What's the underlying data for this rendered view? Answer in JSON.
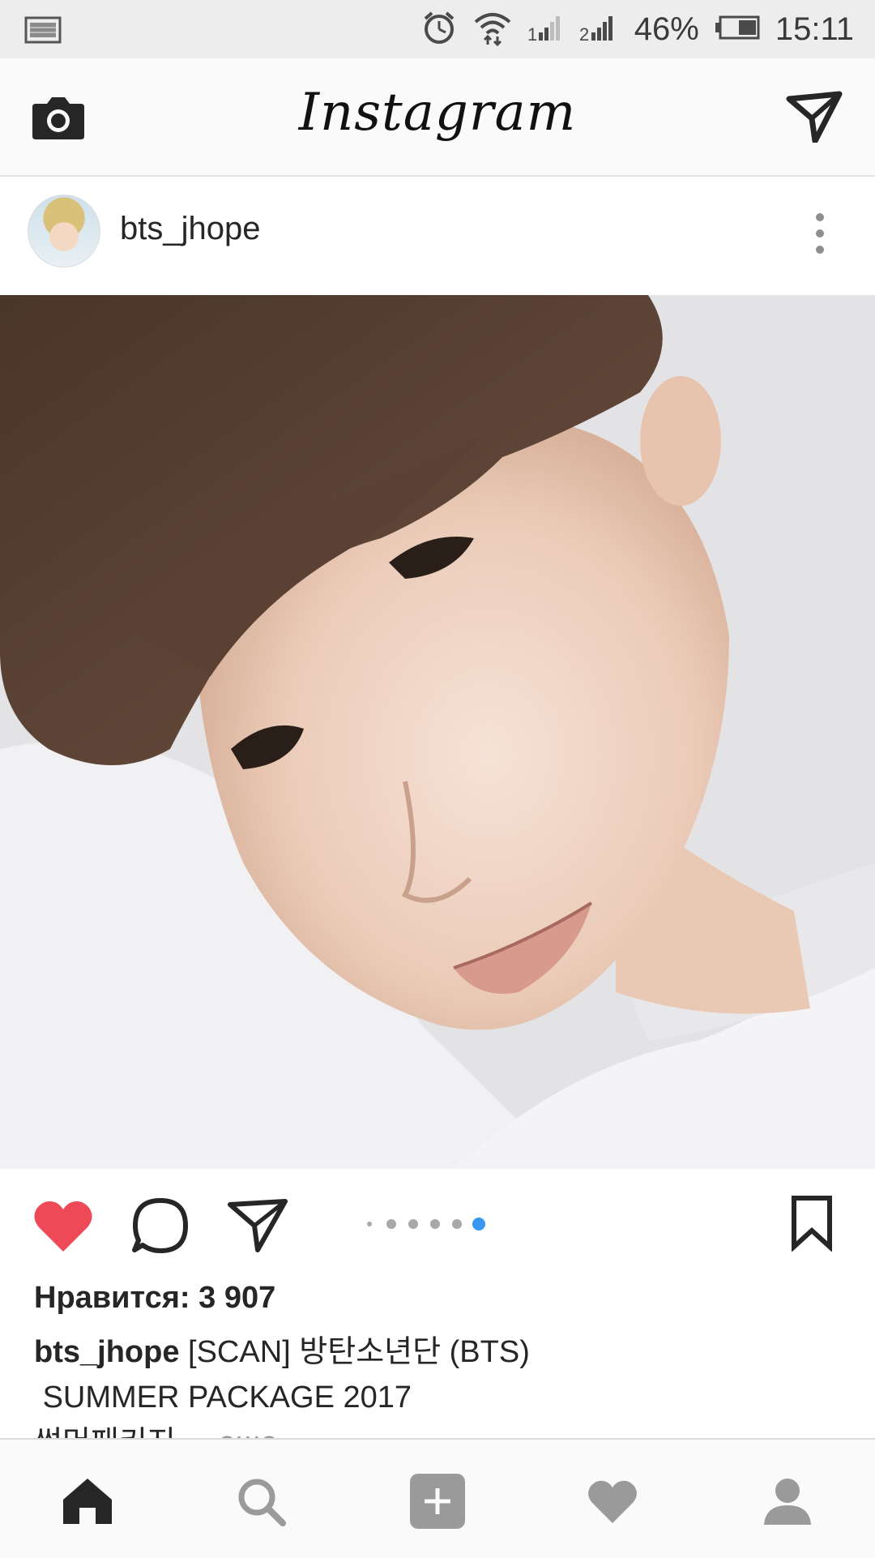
{
  "status_bar": {
    "battery": "46%",
    "time": "15:11"
  },
  "app_bar": {
    "title": "Instagram"
  },
  "post": {
    "username": "bts_jhope",
    "likes_text": "Нравится: 3 907",
    "caption": {
      "username": "bts_jhope",
      "line1": "[SCAN] 방탄소년단 (BTS)",
      "line2": "SUMMER PACKAGE 2017",
      "line3": "썸머패키지",
      "more": "... еще"
    },
    "carousel": {
      "count": 6,
      "active_index": 5
    },
    "liked": true
  },
  "colors": {
    "like_red": "#ed4956",
    "active_dot_blue": "#3897f0",
    "inactive_dot": "#a8a8a8",
    "status_bar_bg": "#ededed",
    "app_bar_bg": "#fafafa"
  },
  "icons": {
    "status_left": "screenshot-icon",
    "alarm": "alarm-icon",
    "wifi": "wifi-icon",
    "signal1": "signal-icon",
    "signal2": "signal-icon",
    "battery": "battery-icon",
    "camera": "camera-icon",
    "direct": "direct-message-icon",
    "more": "more-vertical-icon",
    "like": "heart-icon",
    "comment": "comment-icon",
    "share": "share-icon",
    "save": "bookmark-icon",
    "nav_home": "home-icon",
    "nav_search": "search-icon",
    "nav_add": "add-icon",
    "nav_activity": "heart-icon",
    "nav_profile": "profile-icon"
  }
}
